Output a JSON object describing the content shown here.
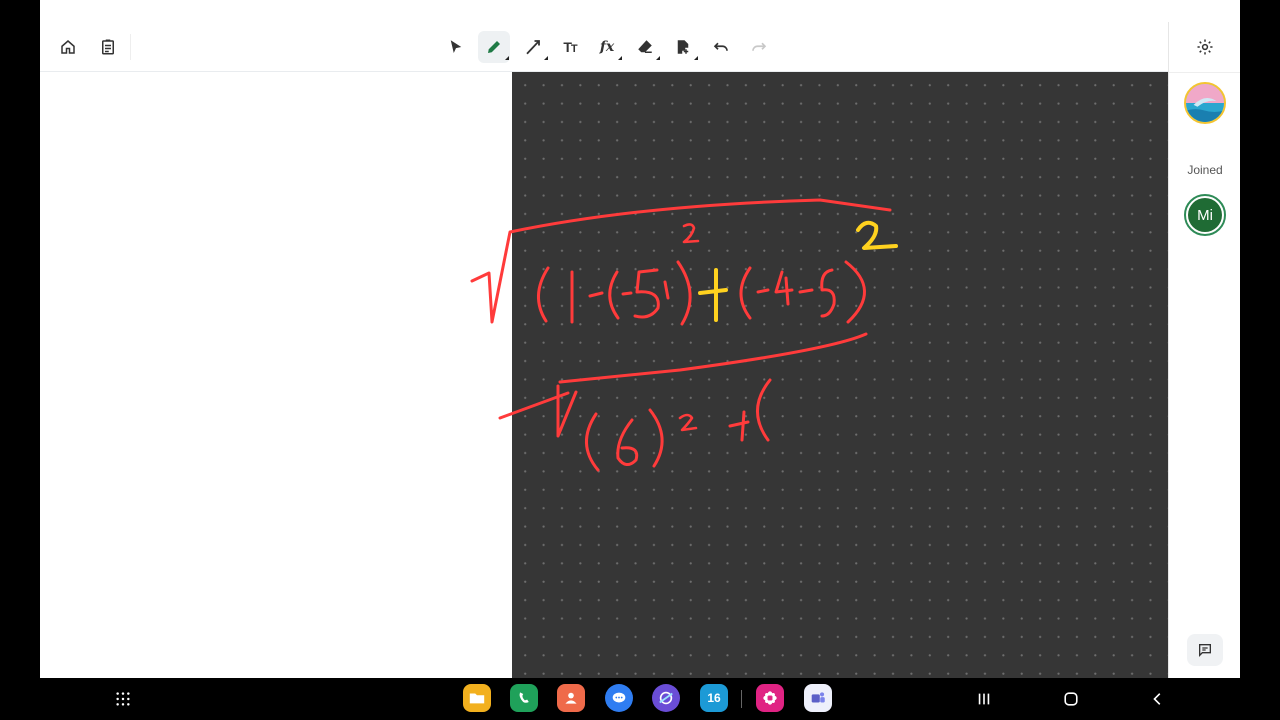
{
  "side_panel": {
    "joined_label": "Joined",
    "participant_initials": "Mi"
  },
  "icons": {
    "toolbar_left": [
      "home-icon",
      "notes-icon"
    ],
    "tools": [
      "select-icon",
      "pen-icon",
      "line-icon",
      "text-icon",
      "formula-icon",
      "eraser-icon",
      "image-icon",
      "undo-icon",
      "redo-icon"
    ],
    "side": [
      "gear-icon",
      "chat-icon"
    ],
    "nav_apps": [
      "folder-app-icon",
      "phone-app-icon",
      "contacts-app-icon",
      "messages-app-icon",
      "internet-app-icon",
      "calendar-app-icon",
      "galaxy-store-app-icon",
      "teams-app-icon"
    ],
    "nav_system": [
      "app-drawer-icon",
      "recent-apps-icon",
      "home-button-icon",
      "back-icon"
    ]
  },
  "calendar_app_day": "16",
  "canvas": {
    "background": "#363636",
    "ink_red": "#ff3b3b",
    "ink_yellow": "#ffd21f"
  },
  "accent": "#1f7a45"
}
